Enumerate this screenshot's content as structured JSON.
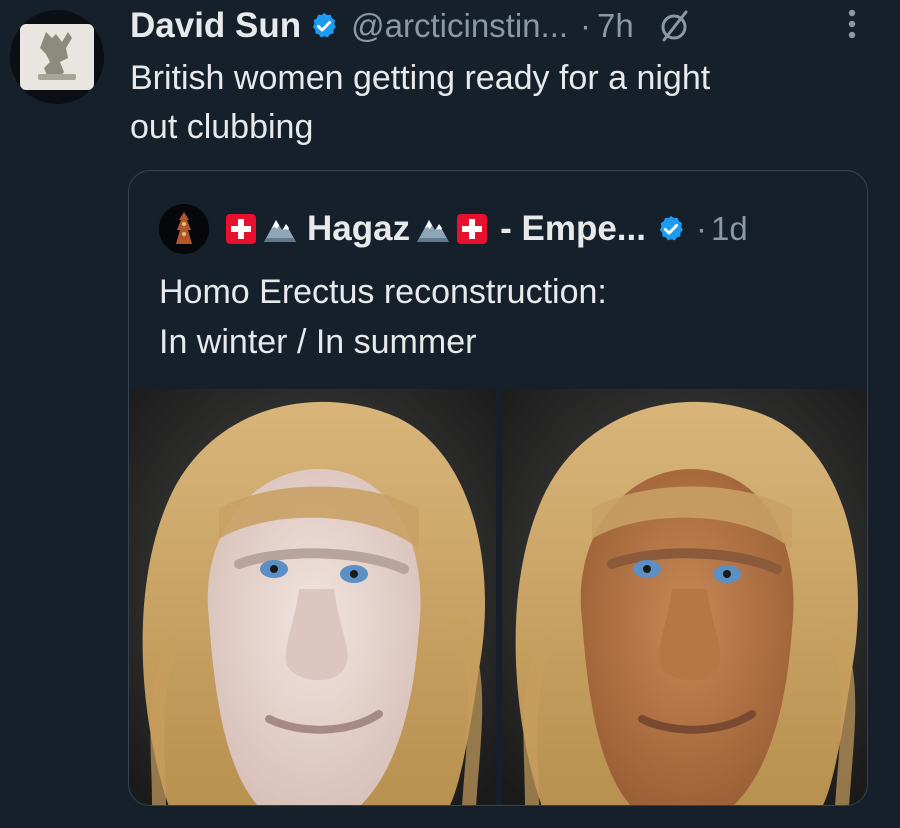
{
  "tweet": {
    "author_name": "David Sun",
    "handle": "@arcticinstin...",
    "separator": "·",
    "time": "7h",
    "text_line1": "British women getting ready for a night",
    "text_line2": "out clubbing"
  },
  "quote": {
    "author_name_part1": "Hagaz",
    "author_name_part2": "- Empe...",
    "separator": "·",
    "time": "1d",
    "text_line1": "Homo Erectus reconstruction:",
    "text_line2": "In winter / In summer"
  },
  "icons": {
    "verified": "verified-badge-icon",
    "edit": "slashed-circle-icon",
    "more": "more-vertical-icon",
    "flag": "swiss-flag-icon",
    "mountain": "snow-mountain-icon"
  },
  "colors": {
    "background": "#15202b",
    "text": "#e7e9ea",
    "muted": "#8b98a5",
    "verified": "#1d9bf0",
    "border": "#38444d",
    "swiss_red": "#e8112d"
  },
  "media": {
    "panels": [
      {
        "skin": "pale",
        "skin_color": "#e9d8d2"
      },
      {
        "skin": "tan",
        "skin_color": "#b9794b"
      }
    ]
  }
}
